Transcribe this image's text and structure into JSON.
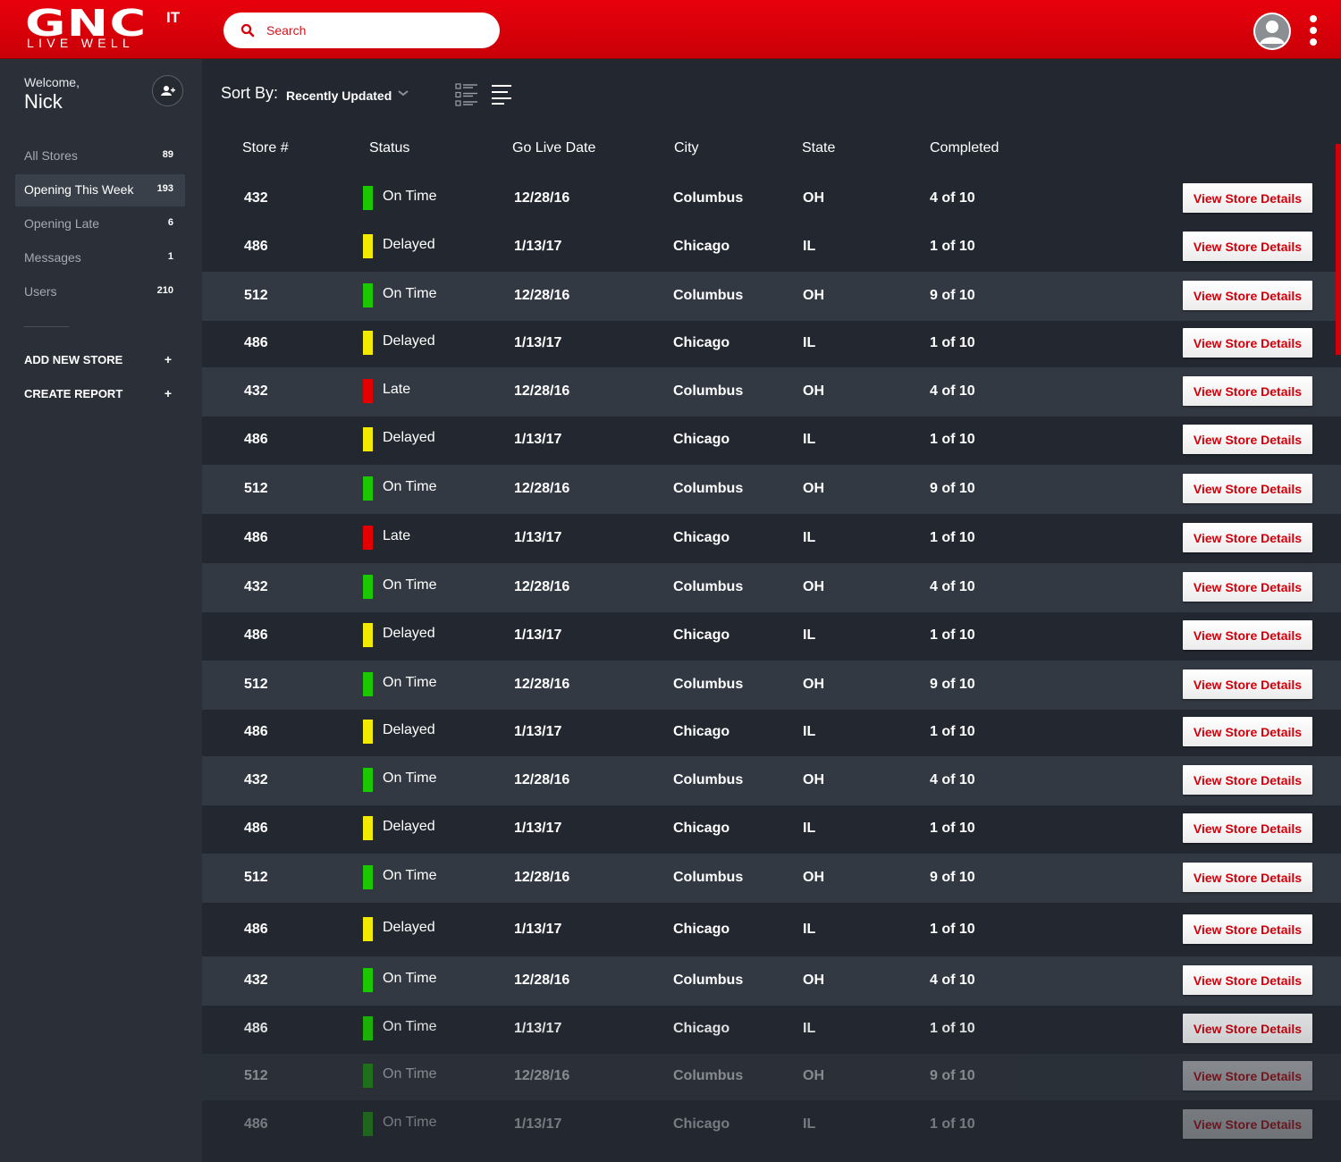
{
  "header": {
    "logo_text": "GNC",
    "logo_suffix": "IT",
    "logo_tagline": "LIVE WELL",
    "search_placeholder": "Search"
  },
  "sidebar": {
    "welcome": "Welcome,",
    "username": "Nick",
    "nav": [
      {
        "label": "All Stores",
        "count": "89"
      },
      {
        "label": "Opening This Week",
        "count": "193"
      },
      {
        "label": "Opening Late",
        "count": "6"
      },
      {
        "label": "Messages",
        "count": "1"
      },
      {
        "label": "Users",
        "count": "210"
      }
    ],
    "actions": [
      {
        "label": "ADD NEW STORE",
        "icon": "+"
      },
      {
        "label": "CREATE REPORT",
        "icon": "+"
      }
    ]
  },
  "toolbar": {
    "sort_label": "Sort By:",
    "sort_value": "Recently Updated"
  },
  "table": {
    "columns": [
      "Store #",
      "Status",
      "Go Live Date",
      "City",
      "State",
      "Completed"
    ],
    "button_label": "View Store Details",
    "status_colors": {
      "On Time": "#1bc800",
      "Delayed": "#f2ea00",
      "Late": "#e30000"
    },
    "rows": [
      {
        "store": "432",
        "status": "On Time",
        "date": "12/28/16",
        "city": "Columbus",
        "state": "OH",
        "completed": "4 of 10"
      },
      {
        "store": "486",
        "status": "Delayed",
        "date": "1/13/17",
        "city": "Chicago",
        "state": "IL",
        "completed": "1 of 10"
      },
      {
        "store": "512",
        "status": "On Time",
        "date": "12/28/16",
        "city": "Columbus",
        "state": "OH",
        "completed": "9 of 10"
      },
      {
        "store": "486",
        "status": "Delayed",
        "date": "1/13/17",
        "city": "Chicago",
        "state": "IL",
        "completed": "1 of 10"
      },
      {
        "store": "432",
        "status": "Late",
        "date": "12/28/16",
        "city": "Columbus",
        "state": "OH",
        "completed": "4 of 10"
      },
      {
        "store": "486",
        "status": "Delayed",
        "date": "1/13/17",
        "city": "Chicago",
        "state": "IL",
        "completed": "1 of 10"
      },
      {
        "store": "512",
        "status": "On Time",
        "date": "12/28/16",
        "city": "Columbus",
        "state": "OH",
        "completed": "9 of 10"
      },
      {
        "store": "486",
        "status": "Late",
        "date": "1/13/17",
        "city": "Chicago",
        "state": "IL",
        "completed": "1 of 10"
      },
      {
        "store": "432",
        "status": "On Time",
        "date": "12/28/16",
        "city": "Columbus",
        "state": "OH",
        "completed": "4 of 10"
      },
      {
        "store": "486",
        "status": "Delayed",
        "date": "1/13/17",
        "city": "Chicago",
        "state": "IL",
        "completed": "1 of 10"
      },
      {
        "store": "512",
        "status": "On Time",
        "date": "12/28/16",
        "city": "Columbus",
        "state": "OH",
        "completed": "9 of 10"
      },
      {
        "store": "486",
        "status": "Delayed",
        "date": "1/13/17",
        "city": "Chicago",
        "state": "IL",
        "completed": "1 of 10"
      },
      {
        "store": "432",
        "status": "On Time",
        "date": "12/28/16",
        "city": "Columbus",
        "state": "OH",
        "completed": "4 of 10"
      },
      {
        "store": "486",
        "status": "Delayed",
        "date": "1/13/17",
        "city": "Chicago",
        "state": "IL",
        "completed": "1 of 10"
      },
      {
        "store": "512",
        "status": "On Time",
        "date": "12/28/16",
        "city": "Columbus",
        "state": "OH",
        "completed": "9 of 10"
      },
      {
        "store": "486",
        "status": "Delayed",
        "date": "1/13/17",
        "city": "Chicago",
        "state": "IL",
        "completed": "1 of 10"
      },
      {
        "store": "432",
        "status": "On Time",
        "date": "12/28/16",
        "city": "Columbus",
        "state": "OH",
        "completed": "4 of 10"
      },
      {
        "store": "486",
        "status": "On Time",
        "date": "1/13/17",
        "city": "Chicago",
        "state": "IL",
        "completed": "1 of 10"
      },
      {
        "store": "512",
        "status": "On Time",
        "date": "12/28/16",
        "city": "Columbus",
        "state": "OH",
        "completed": "9 of 10"
      },
      {
        "store": "486",
        "status": "On Time",
        "date": "1/13/17",
        "city": "Chicago",
        "state": "IL",
        "completed": "1 of 10"
      }
    ]
  }
}
